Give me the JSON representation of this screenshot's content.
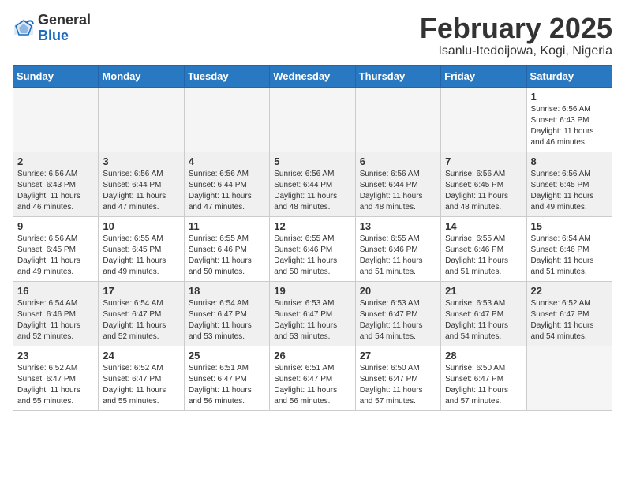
{
  "header": {
    "logo_general": "General",
    "logo_blue": "Blue",
    "month_title": "February 2025",
    "location": "Isanlu-Itedoijowa, Kogi, Nigeria"
  },
  "weekdays": [
    "Sunday",
    "Monday",
    "Tuesday",
    "Wednesday",
    "Thursday",
    "Friday",
    "Saturday"
  ],
  "weeks": [
    {
      "alt": false,
      "days": [
        {
          "num": "",
          "info": ""
        },
        {
          "num": "",
          "info": ""
        },
        {
          "num": "",
          "info": ""
        },
        {
          "num": "",
          "info": ""
        },
        {
          "num": "",
          "info": ""
        },
        {
          "num": "",
          "info": ""
        },
        {
          "num": "1",
          "info": "Sunrise: 6:56 AM\nSunset: 6:43 PM\nDaylight: 11 hours\nand 46 minutes."
        }
      ]
    },
    {
      "alt": true,
      "days": [
        {
          "num": "2",
          "info": "Sunrise: 6:56 AM\nSunset: 6:43 PM\nDaylight: 11 hours\nand 46 minutes."
        },
        {
          "num": "3",
          "info": "Sunrise: 6:56 AM\nSunset: 6:44 PM\nDaylight: 11 hours\nand 47 minutes."
        },
        {
          "num": "4",
          "info": "Sunrise: 6:56 AM\nSunset: 6:44 PM\nDaylight: 11 hours\nand 47 minutes."
        },
        {
          "num": "5",
          "info": "Sunrise: 6:56 AM\nSunset: 6:44 PM\nDaylight: 11 hours\nand 48 minutes."
        },
        {
          "num": "6",
          "info": "Sunrise: 6:56 AM\nSunset: 6:44 PM\nDaylight: 11 hours\nand 48 minutes."
        },
        {
          "num": "7",
          "info": "Sunrise: 6:56 AM\nSunset: 6:45 PM\nDaylight: 11 hours\nand 48 minutes."
        },
        {
          "num": "8",
          "info": "Sunrise: 6:56 AM\nSunset: 6:45 PM\nDaylight: 11 hours\nand 49 minutes."
        }
      ]
    },
    {
      "alt": false,
      "days": [
        {
          "num": "9",
          "info": "Sunrise: 6:56 AM\nSunset: 6:45 PM\nDaylight: 11 hours\nand 49 minutes."
        },
        {
          "num": "10",
          "info": "Sunrise: 6:55 AM\nSunset: 6:45 PM\nDaylight: 11 hours\nand 49 minutes."
        },
        {
          "num": "11",
          "info": "Sunrise: 6:55 AM\nSunset: 6:46 PM\nDaylight: 11 hours\nand 50 minutes."
        },
        {
          "num": "12",
          "info": "Sunrise: 6:55 AM\nSunset: 6:46 PM\nDaylight: 11 hours\nand 50 minutes."
        },
        {
          "num": "13",
          "info": "Sunrise: 6:55 AM\nSunset: 6:46 PM\nDaylight: 11 hours\nand 51 minutes."
        },
        {
          "num": "14",
          "info": "Sunrise: 6:55 AM\nSunset: 6:46 PM\nDaylight: 11 hours\nand 51 minutes."
        },
        {
          "num": "15",
          "info": "Sunrise: 6:54 AM\nSunset: 6:46 PM\nDaylight: 11 hours\nand 51 minutes."
        }
      ]
    },
    {
      "alt": true,
      "days": [
        {
          "num": "16",
          "info": "Sunrise: 6:54 AM\nSunset: 6:46 PM\nDaylight: 11 hours\nand 52 minutes."
        },
        {
          "num": "17",
          "info": "Sunrise: 6:54 AM\nSunset: 6:47 PM\nDaylight: 11 hours\nand 52 minutes."
        },
        {
          "num": "18",
          "info": "Sunrise: 6:54 AM\nSunset: 6:47 PM\nDaylight: 11 hours\nand 53 minutes."
        },
        {
          "num": "19",
          "info": "Sunrise: 6:53 AM\nSunset: 6:47 PM\nDaylight: 11 hours\nand 53 minutes."
        },
        {
          "num": "20",
          "info": "Sunrise: 6:53 AM\nSunset: 6:47 PM\nDaylight: 11 hours\nand 54 minutes."
        },
        {
          "num": "21",
          "info": "Sunrise: 6:53 AM\nSunset: 6:47 PM\nDaylight: 11 hours\nand 54 minutes."
        },
        {
          "num": "22",
          "info": "Sunrise: 6:52 AM\nSunset: 6:47 PM\nDaylight: 11 hours\nand 54 minutes."
        }
      ]
    },
    {
      "alt": false,
      "days": [
        {
          "num": "23",
          "info": "Sunrise: 6:52 AM\nSunset: 6:47 PM\nDaylight: 11 hours\nand 55 minutes."
        },
        {
          "num": "24",
          "info": "Sunrise: 6:52 AM\nSunset: 6:47 PM\nDaylight: 11 hours\nand 55 minutes."
        },
        {
          "num": "25",
          "info": "Sunrise: 6:51 AM\nSunset: 6:47 PM\nDaylight: 11 hours\nand 56 minutes."
        },
        {
          "num": "26",
          "info": "Sunrise: 6:51 AM\nSunset: 6:47 PM\nDaylight: 11 hours\nand 56 minutes."
        },
        {
          "num": "27",
          "info": "Sunrise: 6:50 AM\nSunset: 6:47 PM\nDaylight: 11 hours\nand 57 minutes."
        },
        {
          "num": "28",
          "info": "Sunrise: 6:50 AM\nSunset: 6:47 PM\nDaylight: 11 hours\nand 57 minutes."
        },
        {
          "num": "",
          "info": ""
        }
      ]
    }
  ]
}
